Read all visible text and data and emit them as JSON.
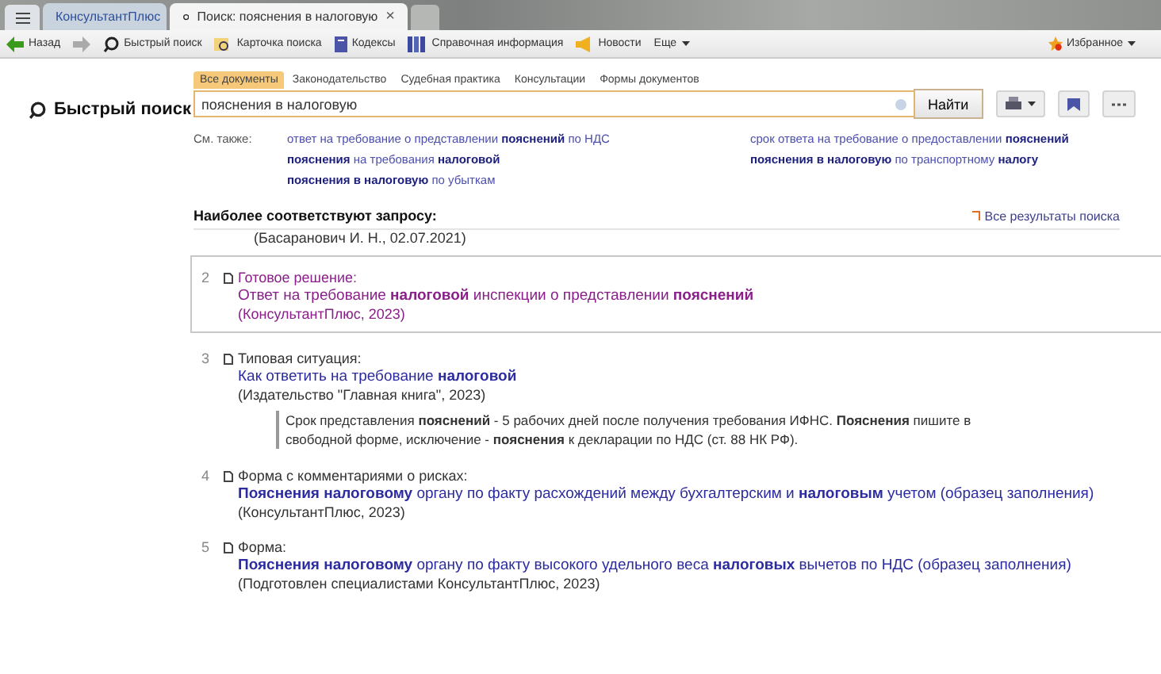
{
  "browser_tabs": [
    {
      "label": "КонсультантПлюс",
      "selected": false
    },
    {
      "label": "Поиск: пояснения в налоговую",
      "selected": true,
      "close": "×"
    }
  ],
  "toolbar": {
    "items": [
      {
        "label": "Назад"
      },
      {
        "label": "Быстрый поиск"
      },
      {
        "label": "Карточка поиска"
      },
      {
        "label": "Кодексы"
      },
      {
        "label": "Справочная информация"
      },
      {
        "label": "Новости"
      },
      {
        "label": "Еще"
      }
    ],
    "favorites": "Избранное"
  },
  "page_title": "Быстрый поиск",
  "search_tabs": [
    {
      "label": "Все документы",
      "selected": true
    },
    {
      "label": "Законодательство",
      "selected": false
    },
    {
      "label": "Судебная практика",
      "selected": false
    },
    {
      "label": "Консультации",
      "selected": false
    },
    {
      "label": "Формы документов",
      "selected": false
    }
  ],
  "search": {
    "value": "пояснения в налоговую",
    "button": "Найти"
  },
  "see_also": {
    "label": "См. также:",
    "links": [
      "ответ на требование о представлении **пояснений** по НДС",
      "срок ответа на требование о предоставлении **пояснений**",
      "**пояснения** на требования **налоговой**",
      "**пояснения в налоговую** по транспортному **налогу**",
      "**пояснения в налоговую** по убыткам"
    ]
  },
  "results": {
    "heading": "Наиболее соответствуют запросу:",
    "all_link": "Все результаты поиска",
    "cut_source": "(Басаранович И. Н., 02.07.2021)",
    "items": [
      {
        "number": "2",
        "kind": "Готовое решение:",
        "title": "Ответ на требование **налоговой** инспекции о представлении **пояснений**",
        "source": "(КонсультантПлюс, 2023)",
        "selected": true,
        "visited": true
      },
      {
        "number": "3",
        "kind": "Типовая ситуация:",
        "title": "Как ответить на требование **налоговой**",
        "source": "(Издательство \"Главная книга\", 2023)",
        "snippet": "Срок представления **пояснений** - 5 рабочих дней после получения требования ИФНС. **Пояснения** пишите в свободной форме, исключение - **пояснения** к декларации по НДС (ст. 88 НК РФ).",
        "selected": false,
        "visited": false
      },
      {
        "number": "4",
        "kind": "Форма с комментариями о рисках:",
        "title": "**Пояснения налоговому** органу по факту расхождений между бухгалтерским и **налоговым** учетом (образец заполнения)",
        "source": "(КонсультантПлюс, 2023)",
        "selected": false,
        "visited": false
      },
      {
        "number": "5",
        "kind": "Форма:",
        "title": "**Пояснения налоговому** органу по факту высокого удельного веса **налоговых** вычетов по НДС (образец заполнения)",
        "source": "(Подготовлен специалистами КонсультантПлюс, 2023)",
        "selected": false,
        "visited": false
      }
    ]
  }
}
